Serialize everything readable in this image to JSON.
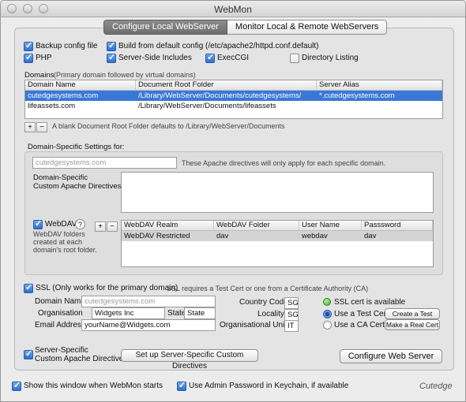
{
  "window": {
    "title": "WebMon"
  },
  "tabs": [
    {
      "label": "Configure Local WebServer",
      "active": true
    },
    {
      "label": "Monitor Local & Remote WebServers",
      "active": false
    }
  ],
  "options": {
    "backup": "Backup config file",
    "build_default": "Build from default config (/etc/apache2/httpd.conf.default)",
    "php": "PHP",
    "ssi": "Server-Side Includes",
    "execcgi": "ExecCGI",
    "dirlisting": "Directory Listing"
  },
  "domains": {
    "label": "Domains",
    "hint": "(Primary domain followed by virtual domains)",
    "columns": [
      "Domain Name",
      "Document Root Folder",
      "Server Alias"
    ],
    "rows": [
      {
        "name": "cutedgesystems.com",
        "root": "/Library/WebServer/Documents/cutedgesystems/",
        "alias": "*.cutedgesystems.com",
        "selected": true
      },
      {
        "name": "lifeassets.com",
        "root": "/Library/WebServer/Documents/lifeassets",
        "alias": "",
        "selected": false
      }
    ],
    "plus": "+",
    "minus": "−",
    "note": "A blank Document Root Folder defaults to /Library/WebServer/Documents"
  },
  "domain_specific": {
    "label": "Domain-Specific Settings for:",
    "domain_value": "cutedgesystems.com",
    "note": "These Apache directives will only apply for each specific domain.",
    "directives_label_1": "Domain-Specific",
    "directives_label_2": "Custom Apache Directives",
    "webdav_label": "WebDAV",
    "help": "?",
    "webdav_note_1": "WebDAV folders",
    "webdav_note_2": "created at each",
    "webdav_note_3": "domain's root folder.",
    "webdav_columns": [
      "WebDAV Realm",
      "WebDAV Folder",
      "User Name",
      "Passsword"
    ],
    "webdav_rows": [
      {
        "realm": "WebDAV Restricted",
        "folder": "dav",
        "user": "webdav",
        "password": "dav"
      }
    ]
  },
  "ssl": {
    "label": "SSL (Only works for the primary domain)",
    "note": "SSL requires a Test Cert or one from a Certificate Authority (CA)",
    "domain_name_label": "Domain Name",
    "domain_name_placeholder": "cutedgesystems.com",
    "organisation_label": "Organisation",
    "organisation": "Widgets Inc",
    "state_label": "State",
    "state": "State",
    "email_label": "Email Address",
    "email": "yourName@Widgets.com",
    "country_label": "Country Code",
    "country": "SG",
    "locality_label": "Locality",
    "locality": "SG",
    "unit_label": "Organisational Unit",
    "unit": "IT",
    "status": "SSL cert is available",
    "status_color": "#3bab2a",
    "use_test": "Use a Test Cert",
    "use_ca": "Use a CA Cert",
    "create_test": "Create a Test Cert",
    "make_real": "Make a Real Cert"
  },
  "server_specific": {
    "label_1": "Server-Specific",
    "label_2": "Custom Apache Directives",
    "button": "Set up Server-Specific Custom Directives",
    "configure": "Configure Web Server"
  },
  "footer": {
    "show_window": "Show this window when WebMon starts",
    "use_admin": "Use Admin Password in Keychain, if available",
    "brand": "Cutedge"
  }
}
